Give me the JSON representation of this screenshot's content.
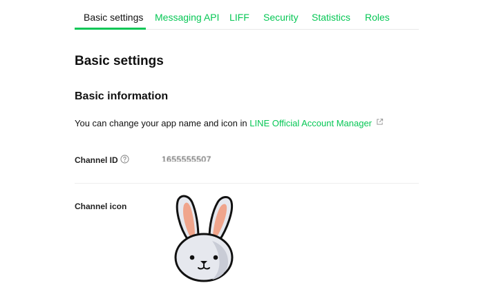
{
  "tabs": [
    {
      "label": "Basic settings",
      "active": true
    },
    {
      "label": "Messaging API",
      "active": false
    },
    {
      "label": "LIFF",
      "active": false
    },
    {
      "label": "Security",
      "active": false
    },
    {
      "label": "Statistics",
      "active": false
    },
    {
      "label": "Roles",
      "active": false
    }
  ],
  "page_title": "Basic settings",
  "section": {
    "title": "Basic information",
    "description_prefix": "You can change your app name and icon in ",
    "description_link": "LINE Official Account Manager",
    "link_icon": "external-link-icon"
  },
  "fields": {
    "channel_id": {
      "label": "Channel ID",
      "help_icon": "question-circle-icon",
      "value": "1655555507"
    },
    "channel_icon": {
      "label": "Channel icon",
      "icon": "rabbit-icon"
    }
  },
  "colors": {
    "accent": "#06c755",
    "text": "#111111",
    "divider": "#eeeeee"
  }
}
